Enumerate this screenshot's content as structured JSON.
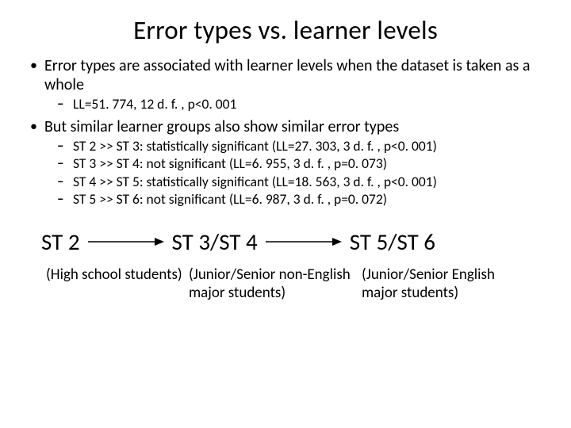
{
  "title": "Error types vs. learner levels",
  "bullets": {
    "b1": "Error types are associated with learner levels when the dataset is taken as a whole",
    "b1_sub1": "LL=51. 774, 12 d. f. , p<0. 001",
    "b2": "But similar learner groups also show similar error types",
    "b2_sub1": "ST 2 >> ST 3: statistically significant (LL=27. 303, 3 d. f. , p<0. 001)",
    "b2_sub2": "ST 3 >> ST 4: not significant (LL=6. 955, 3 d. f. , p=0. 073)",
    "b2_sub3": "ST 4 >> ST 5: statistically significant (LL=18. 563, 3 d. f. , p<0. 001)",
    "b2_sub4": "ST 5 >> ST 6: not significant (LL=6. 987, 3 d. f. , p=0. 072)"
  },
  "groups": {
    "g1": "ST 2",
    "g2": "ST 3/ST 4",
    "g3": "ST 5/ST 6"
  },
  "descs": {
    "d1": "(High school students)",
    "d2": "(Junior/Senior non-English major students)",
    "d3": "(Junior/Senior English major students)"
  }
}
